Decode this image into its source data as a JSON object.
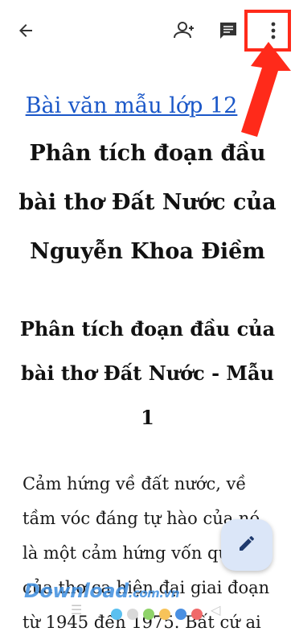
{
  "toolbar": {
    "back_icon": "arrow-left-icon",
    "share_icon": "add-person-icon",
    "comment_icon": "comment-icon",
    "more_icon": "more-vert-icon",
    "highlight_color": "#ff2a1a"
  },
  "document": {
    "link_title": "Bài văn mẫu lớp 12",
    "main_title": "Phân tích đoạn đầu bài thơ Đất Nước của Nguyễn Khoa Điềm",
    "section_title": "Phân tích đoạn đầu của bài thơ Đất Nước - Mẫu 1",
    "paragraph": "Cảm hứng về đất nước, về tầm vóc đáng tự hào của nó là một cảm hứng vốn quen của thơ ca hiện đại giai đoạn từ 1945 đến 1975. Bất cứ ai"
  },
  "fab": {
    "icon": "pencil-icon"
  },
  "watermark": {
    "brand": "Download",
    "suffix": ".com.vn"
  },
  "colors": {
    "link": "#1a57c8",
    "fab_bg": "#dbe6f8",
    "accent": "#ff2a1a"
  }
}
